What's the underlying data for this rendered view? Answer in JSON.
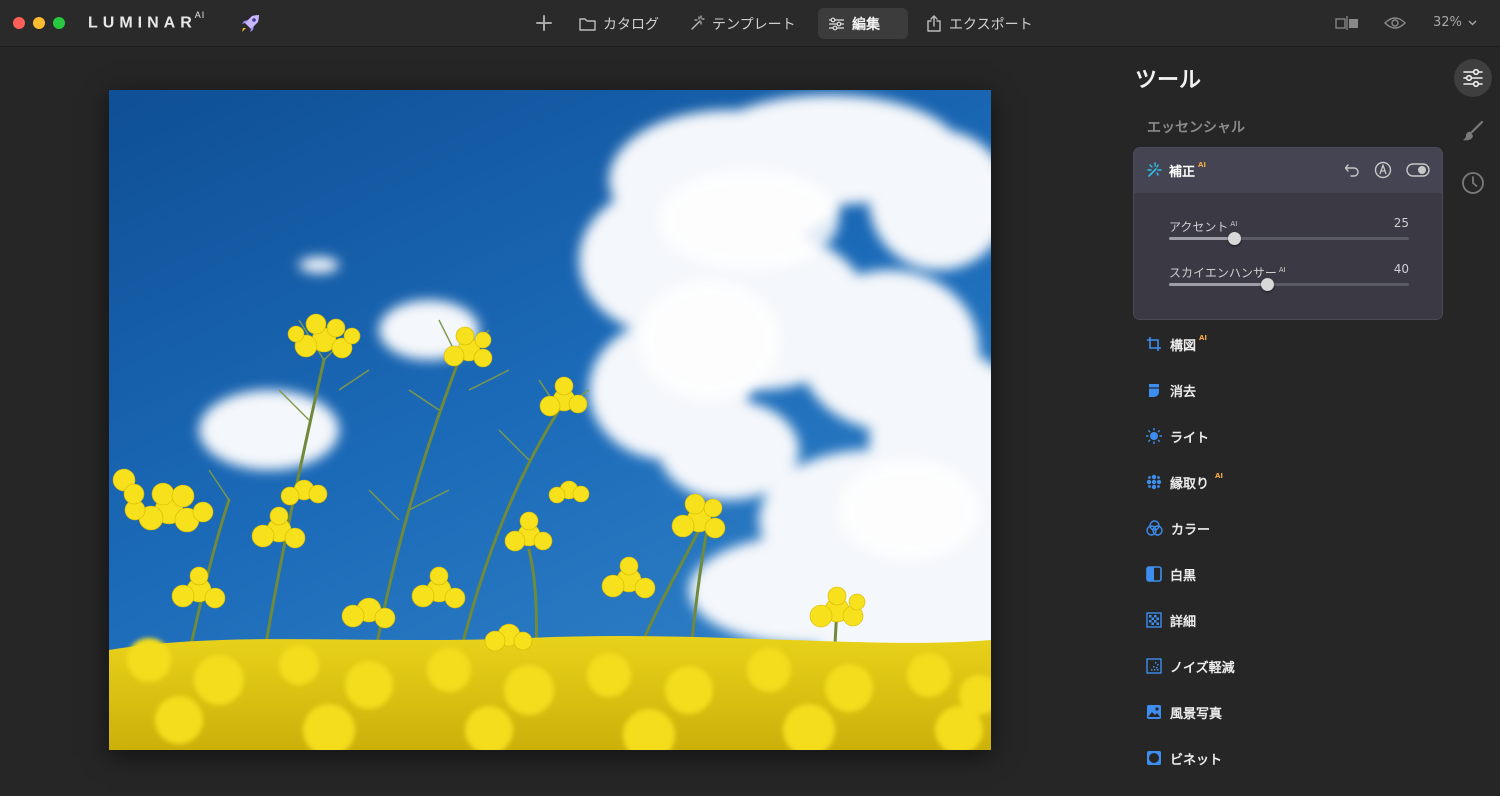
{
  "app": {
    "brand": "LUMINAR",
    "brand_sup": "AI",
    "traffic_colors": [
      "#ff5f57",
      "#febc2e",
      "#28c840"
    ]
  },
  "nav": {
    "add_icon": "plus-icon",
    "items": [
      {
        "label": "カタログ",
        "icon": "folder-icon",
        "active": false
      },
      {
        "label": "テンプレート",
        "icon": "magic-wand-icon",
        "active": false
      },
      {
        "label": "編集",
        "icon": "sliders-icon",
        "active": true
      },
      {
        "label": "エクスポート",
        "icon": "share-icon",
        "active": false
      }
    ]
  },
  "view": {
    "zoom": "32%",
    "compare_icon": "compare-icon",
    "preview_icon": "eye-icon"
  },
  "panel": {
    "title": "ツール",
    "section": "エッセンシャル",
    "active_tool": {
      "name": "補正",
      "ai_badge": "AI",
      "sliders": [
        {
          "label": "アクセント",
          "ai": "AI",
          "value": "25",
          "fraction": 0.27
        },
        {
          "label": "スカイエンハンサー",
          "ai": "AI",
          "value": "40",
          "fraction": 0.41
        }
      ]
    },
    "tools": [
      {
        "label": "構図",
        "ai": "AI",
        "icon": "crop-icon"
      },
      {
        "label": "消去",
        "ai": "",
        "icon": "eraser-icon"
      },
      {
        "label": "ライト",
        "ai": "",
        "icon": "sun-icon"
      },
      {
        "label": "縁取り",
        "ai": "AI",
        "icon": "dots-icon"
      },
      {
        "label": "カラー",
        "ai": "",
        "icon": "color-circles-icon"
      },
      {
        "label": "白黒",
        "ai": "",
        "icon": "half-square-icon"
      },
      {
        "label": "詳細",
        "ai": "",
        "icon": "checker-icon"
      },
      {
        "label": "ノイズ軽減",
        "ai": "",
        "icon": "noise-icon"
      },
      {
        "label": "風景写真",
        "ai": "",
        "icon": "landscape-icon"
      },
      {
        "label": "ビネット",
        "ai": "",
        "icon": "vignette-icon"
      }
    ]
  },
  "colors": {
    "accent_blue": "#3d8ef0",
    "cyan": "#2fc0e8",
    "ai_orange": "#f2a744"
  }
}
